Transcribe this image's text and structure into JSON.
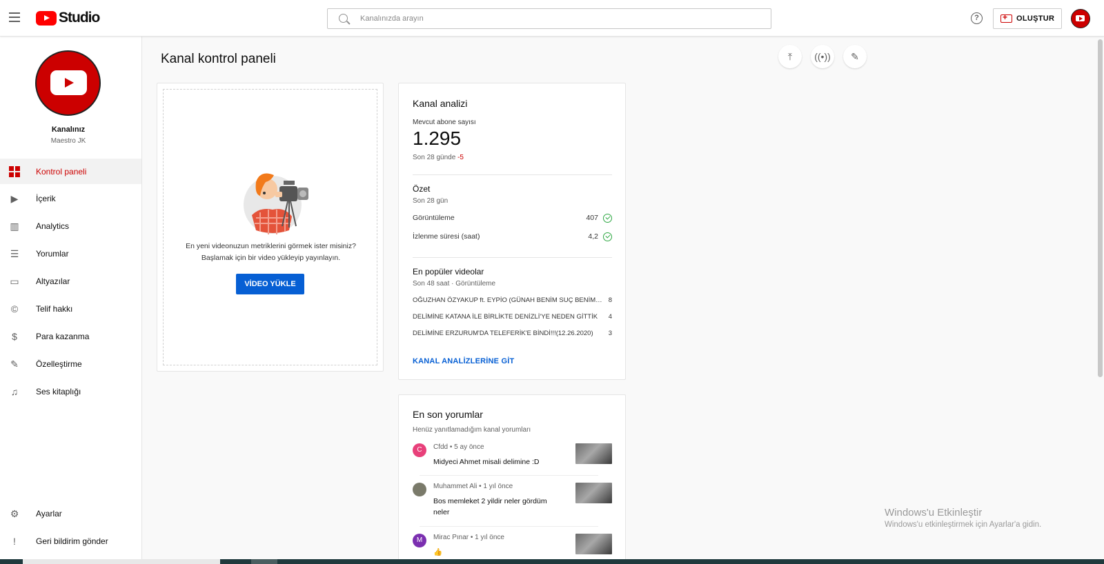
{
  "header": {
    "logo_text": "Studio",
    "search_placeholder": "Kanalınızda arayın",
    "help_label": "?",
    "create_label": "OLUŞTUR"
  },
  "sidebar": {
    "channel_name": "Kanalınız",
    "channel_handle": "Maestro JK",
    "items": [
      {
        "label": "Kontrol paneli",
        "icon": "dashboard-icon",
        "active": true
      },
      {
        "label": "İçerik",
        "icon": "content-icon"
      },
      {
        "label": "Analytics",
        "icon": "analytics-icon"
      },
      {
        "label": "Yorumlar",
        "icon": "comments-icon"
      },
      {
        "label": "Altyazılar",
        "icon": "subtitles-icon"
      },
      {
        "label": "Telif hakkı",
        "icon": "copyright-icon"
      },
      {
        "label": "Para kazanma",
        "icon": "dollar-icon"
      },
      {
        "label": "Özelleştirme",
        "icon": "magic-wand-icon"
      },
      {
        "label": "Ses kitaplığı",
        "icon": "audio-library-icon"
      }
    ],
    "bottom_items": [
      {
        "label": "Ayarlar",
        "icon": "gear-icon"
      },
      {
        "label": "Geri bildirim gönder",
        "icon": "feedback-icon"
      }
    ]
  },
  "main": {
    "title": "Kanal kontrol paneli",
    "upload_card": {
      "message_line1": "En yeni videonuzun metriklerini görmek ister misiniz?",
      "message_line2": "Başlamak için bir video yükleyip yayınlayın.",
      "button_label": "VİDEO YÜKLE"
    },
    "analytics": {
      "title": "Kanal analizi",
      "subscribers_label": "Mevcut abone sayısı",
      "subscribers_value": "1.295",
      "change_prefix": "Son 28 günde",
      "change_value": "-5",
      "summary_title": "Özet",
      "summary_period": "Son 28 gün",
      "metrics": [
        {
          "label": "Görüntüleme",
          "value": "407"
        },
        {
          "label": "İzlenme süresi (saat)",
          "value": "4,2"
        }
      ],
      "top_videos_title": "En popüler videolar",
      "top_videos_period": "Son 48 saat · Görüntüleme",
      "top_videos": [
        {
          "title": "OĞUZHAN ÖZYAKUP ft. EYPİO (GÜNAH BENİM SUÇ BENİM) SÖZLERİ",
          "views": "8"
        },
        {
          "title": "DELİMİNE KATANA İLE BİRLİKTE DENİZLİ'YE NEDEN GİTTİK",
          "views": "4"
        },
        {
          "title": "DELİMİNE ERZURUM'DA TELEFERİK'E BİNDİ!!!(12.26.2020)",
          "views": "3"
        }
      ],
      "link_label": "KANAL ANALİZLERİNE GİT"
    },
    "comments": {
      "title": "En son yorumlar",
      "subtitle": "Henüz yanıtlamadığım kanal yorumları",
      "items": [
        {
          "initial": "C",
          "color": "#e8407a",
          "meta": "Cfdd • 5 ay önce",
          "text": "Midyeci Ahmet misali delimine :D"
        },
        {
          "initial": "",
          "color": "#7a7a6a",
          "meta": "Muhammet Ali • 1 yıl önce",
          "text": "Bos memleket 2 yildir neler gördüm neler"
        },
        {
          "initial": "M",
          "color": "#7b2fb0",
          "meta": "Mirac Pınar • 1 yıl önce",
          "text": "👍"
        }
      ]
    }
  },
  "watermark": {
    "line1": "Windows'u Etkinleştir",
    "line2": "Windows'u etkinleştirmek için Ayarlar'a gidin."
  }
}
